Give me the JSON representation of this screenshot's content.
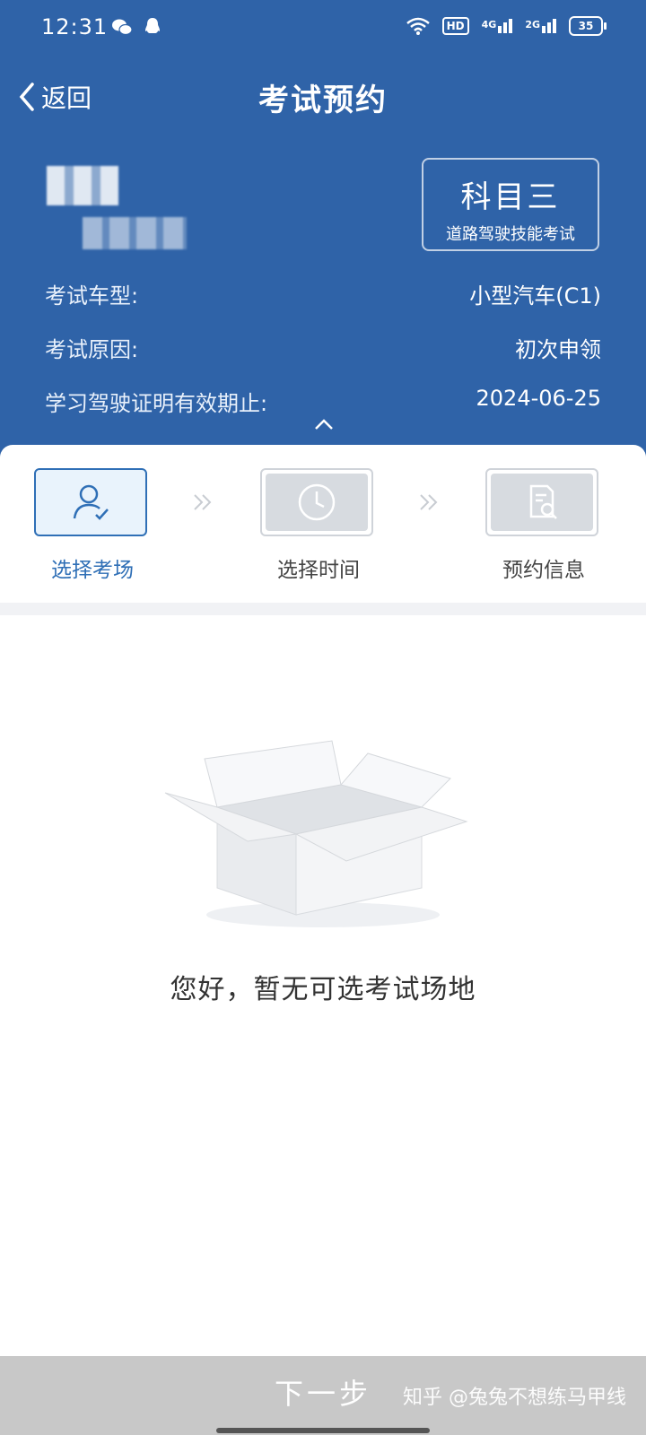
{
  "status_bar": {
    "time": "12:31",
    "hd_label": "HD",
    "signal_1": "4G",
    "signal_2": "2G",
    "battery": "35"
  },
  "nav": {
    "back_label": "返回",
    "title": "考试预约"
  },
  "subject": {
    "name": "科目三",
    "description": "道路驾驶技能考试"
  },
  "info_rows": [
    {
      "label": "考试车型:",
      "value": "小型汽车(C1)"
    },
    {
      "label": "考试原因:",
      "value": "初次申领"
    },
    {
      "label": "学习驾驶证明有效期止:",
      "value": "2024-06-25"
    }
  ],
  "steps": [
    {
      "label": "选择考场",
      "state": "active",
      "icon": "person-check-icon"
    },
    {
      "label": "选择时间",
      "state": "inactive",
      "icon": "clock-icon"
    },
    {
      "label": "预约信息",
      "state": "inactive",
      "icon": "document-search-icon"
    }
  ],
  "empty_state": {
    "message": "您好，暂无可选考试场地",
    "icon": "empty-box-icon"
  },
  "footer": {
    "next_label": "下一步",
    "watermark": "知乎 @兔兔不想练马甲线"
  },
  "colors": {
    "header_bg": "#2f63a8",
    "accent": "#2f6fb6",
    "footer_bg": "#c8c8c8"
  }
}
